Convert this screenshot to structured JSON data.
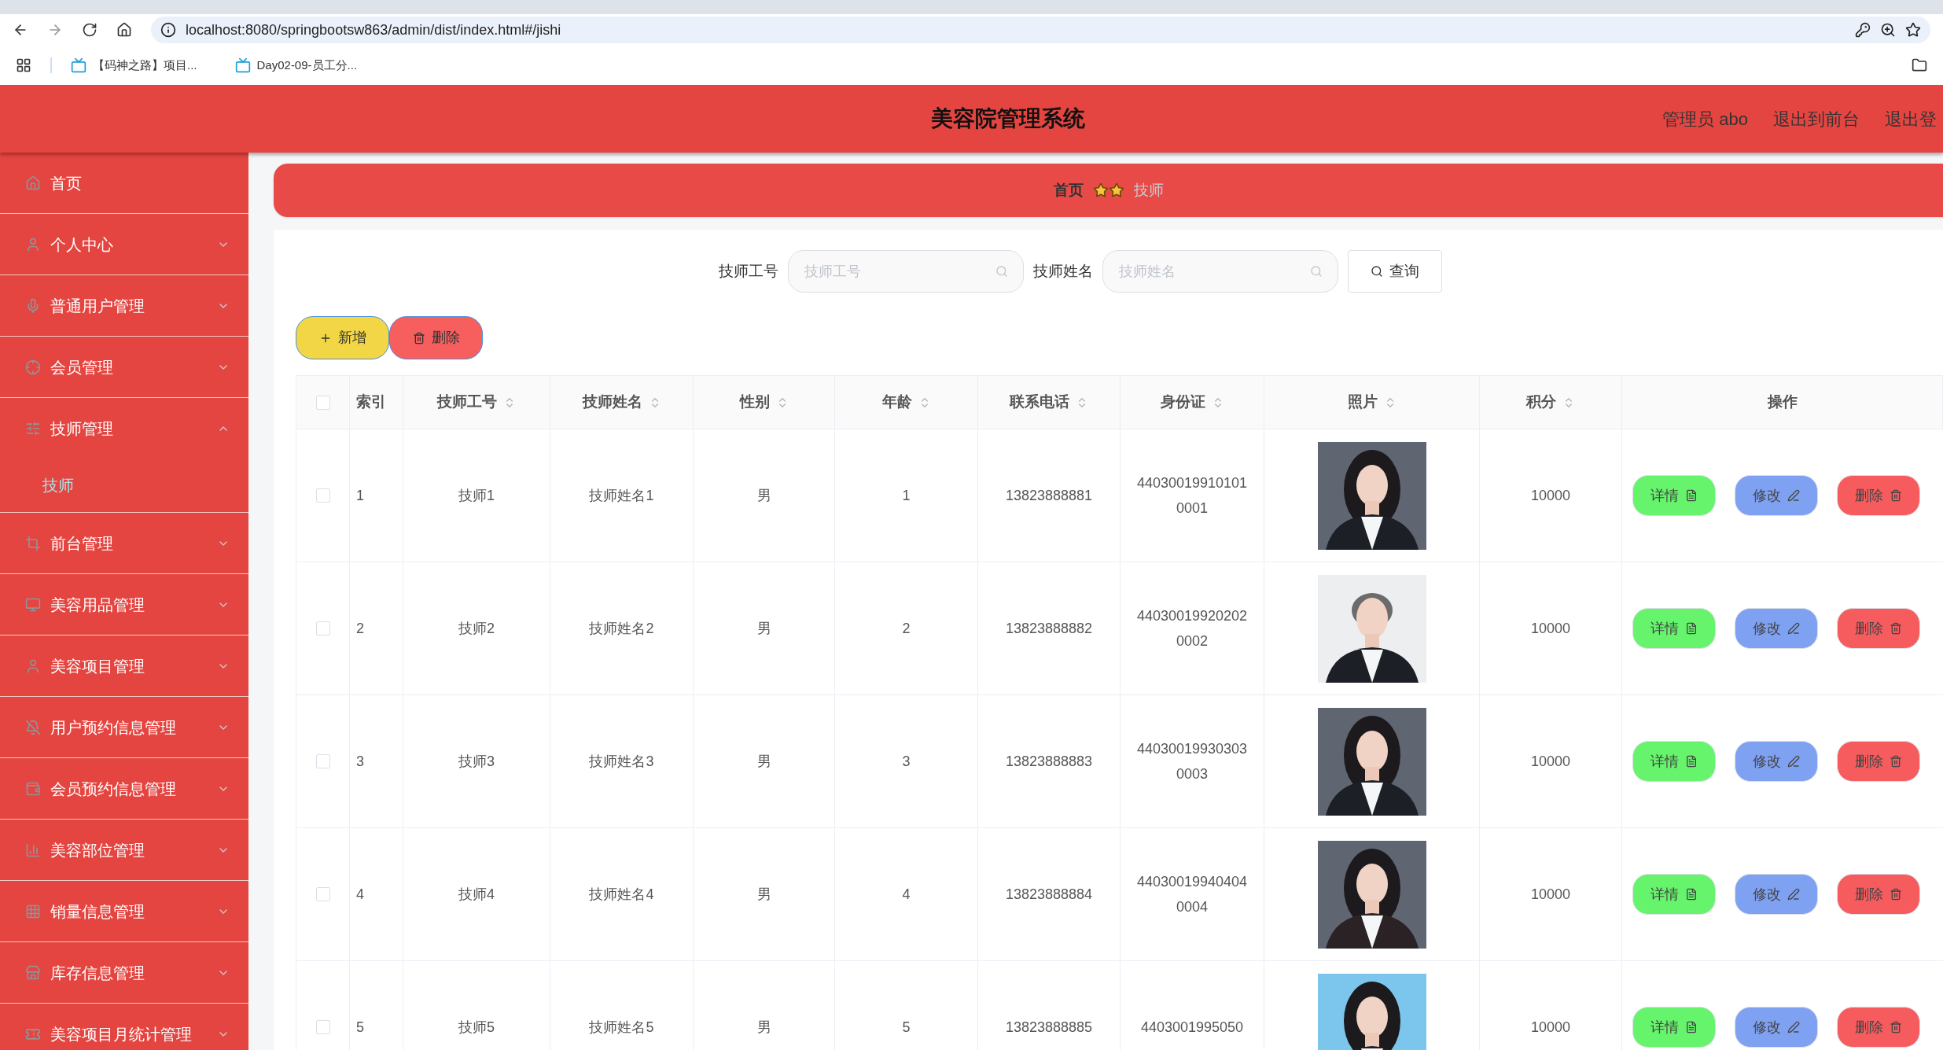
{
  "browser": {
    "url": "localhost:8080/springbootsw863/admin/dist/index.html#/jishi",
    "bookmarks": [
      "【码神之路】项目...",
      "Day02-09-员工分..."
    ]
  },
  "header": {
    "title": "美容院管理系统",
    "links": [
      "管理员 abo",
      "退出到前台",
      "退出登"
    ]
  },
  "sidebar": {
    "items": [
      {
        "label": "首页"
      },
      {
        "label": "个人中心",
        "expanded": false
      },
      {
        "label": "普通用户管理",
        "expanded": false
      },
      {
        "label": "会员管理",
        "expanded": false
      },
      {
        "label": "技师管理",
        "expanded": true,
        "children": [
          {
            "label": "技师",
            "selected": true
          }
        ]
      },
      {
        "label": "前台管理",
        "expanded": false
      },
      {
        "label": "美容用品管理",
        "expanded": false
      },
      {
        "label": "美容项目管理",
        "expanded": false
      },
      {
        "label": "用户预约信息管理",
        "expanded": false
      },
      {
        "label": "会员预约信息管理",
        "expanded": false
      },
      {
        "label": "美容部位管理",
        "expanded": false
      },
      {
        "label": "销量信息管理",
        "expanded": false
      },
      {
        "label": "库存信息管理",
        "expanded": false
      },
      {
        "label": "美容项目月统计管理",
        "expanded": false
      }
    ]
  },
  "breadcrumb": [
    "首页",
    "技师"
  ],
  "search": {
    "fields": [
      {
        "label": "技师工号",
        "placeholder": "技师工号"
      },
      {
        "label": "技师姓名",
        "placeholder": "技师姓名"
      }
    ],
    "button": "查询"
  },
  "actions": [
    {
      "label": "新增",
      "kind": "add"
    },
    {
      "label": "删除",
      "kind": "delete"
    }
  ],
  "table": {
    "header_checked": false,
    "columns": [
      {
        "label": "索引",
        "sortable": false
      },
      {
        "label": "技师工号",
        "sortable": true
      },
      {
        "label": "技师姓名",
        "sortable": true
      },
      {
        "label": "性别",
        "sortable": true
      },
      {
        "label": "年龄",
        "sortable": true
      },
      {
        "label": "联系电话",
        "sortable": true
      },
      {
        "label": "身份证",
        "sortable": true
      },
      {
        "label": "照片",
        "sortable": true
      },
      {
        "label": "积分",
        "sortable": true
      },
      {
        "label": "操作",
        "sortable": false
      }
    ],
    "rows": [
      {
        "checked": false,
        "index": "1",
        "number": "技师1",
        "name": "技师姓名1",
        "gender": "男",
        "age": "1",
        "phone": "13823888881",
        "id_card": "440300199101010001",
        "points": "10000",
        "buttons": [
          {
            "label": "详情",
            "kind": "detail"
          },
          {
            "label": "修改",
            "kind": "edit"
          },
          {
            "label": "删除",
            "kind": "delete"
          }
        ]
      },
      {
        "checked": false,
        "index": "2",
        "number": "技师2",
        "name": "技师姓名2",
        "gender": "男",
        "age": "2",
        "phone": "13823888882",
        "id_card": "440300199202020002",
        "points": "10000",
        "buttons": [
          {
            "label": "详情",
            "kind": "detail"
          },
          {
            "label": "修改",
            "kind": "edit"
          },
          {
            "label": "删除",
            "kind": "delete"
          }
        ]
      },
      {
        "checked": false,
        "index": "3",
        "number": "技师3",
        "name": "技师姓名3",
        "gender": "男",
        "age": "3",
        "phone": "13823888883",
        "id_card": "440300199303030003",
        "points": "10000",
        "buttons": [
          {
            "label": "详情",
            "kind": "detail"
          },
          {
            "label": "修改",
            "kind": "edit"
          },
          {
            "label": "删除",
            "kind": "delete"
          }
        ]
      },
      {
        "checked": false,
        "index": "4",
        "number": "技师4",
        "name": "技师姓名4",
        "gender": "男",
        "age": "4",
        "phone": "13823888884",
        "id_card": "440300199404040004",
        "points": "10000",
        "buttons": [
          {
            "label": "详情",
            "kind": "detail"
          },
          {
            "label": "修改",
            "kind": "edit"
          },
          {
            "label": "删除",
            "kind": "delete"
          }
        ]
      },
      {
        "checked": false,
        "index": "5",
        "number": "技师5",
        "name": "技师姓名5",
        "gender": "男",
        "age": "5",
        "phone": "13823888885",
        "id_card": "4403001995050",
        "points": "10000",
        "buttons": [
          {
            "label": "详情",
            "kind": "detail"
          },
          {
            "label": "修改",
            "kind": "edit"
          },
          {
            "label": "删除",
            "kind": "delete"
          }
        ]
      }
    ]
  }
}
